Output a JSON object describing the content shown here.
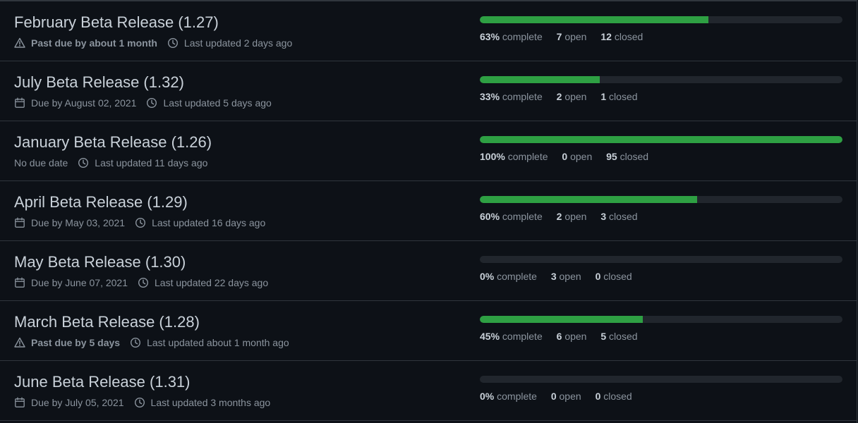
{
  "labels": {
    "complete": "complete",
    "open": "open",
    "closed": "closed"
  },
  "colors": {
    "background": "#0d1117",
    "progress_fill": "#2ea043",
    "progress_track": "#21262d",
    "title": "#c9d1d9",
    "muted": "#8b949e"
  },
  "milestones": [
    {
      "title": "February Beta Release (1.27)",
      "due_icon": "alert-icon",
      "due_text": "Past due by about 1 month",
      "due_style": "past-due",
      "updated_text": "Last updated 2 days ago",
      "progress": 0.63,
      "percent": "63%",
      "open": "7",
      "closed": "12"
    },
    {
      "title": "July Beta Release (1.32)",
      "due_icon": "calendar-icon",
      "due_text": "Due by August 02, 2021",
      "due_style": "due",
      "updated_text": "Last updated 5 days ago",
      "progress": 0.33,
      "percent": "33%",
      "open": "2",
      "closed": "1"
    },
    {
      "title": "January Beta Release (1.26)",
      "due_icon": "",
      "due_text": "No due date",
      "due_style": "none",
      "updated_text": "Last updated 11 days ago",
      "progress": 1.0,
      "percent": "100%",
      "open": "0",
      "closed": "95"
    },
    {
      "title": "April Beta Release (1.29)",
      "due_icon": "calendar-icon",
      "due_text": "Due by May 03, 2021",
      "due_style": "due",
      "updated_text": "Last updated 16 days ago",
      "progress": 0.6,
      "percent": "60%",
      "open": "2",
      "closed": "3"
    },
    {
      "title": "May Beta Release (1.30)",
      "due_icon": "calendar-icon",
      "due_text": "Due by June 07, 2021",
      "due_style": "due",
      "updated_text": "Last updated 22 days ago",
      "progress": 0.0,
      "percent": "0%",
      "open": "3",
      "closed": "0"
    },
    {
      "title": "March Beta Release (1.28)",
      "due_icon": "alert-icon",
      "due_text": "Past due by 5 days",
      "due_style": "past-due",
      "updated_text": "Last updated about 1 month ago",
      "progress": 0.45,
      "percent": "45%",
      "open": "6",
      "closed": "5"
    },
    {
      "title": "June Beta Release (1.31)",
      "due_icon": "calendar-icon",
      "due_text": "Due by July 05, 2021",
      "due_style": "due",
      "updated_text": "Last updated 3 months ago",
      "progress": 0.0,
      "percent": "0%",
      "open": "0",
      "closed": "0"
    }
  ]
}
